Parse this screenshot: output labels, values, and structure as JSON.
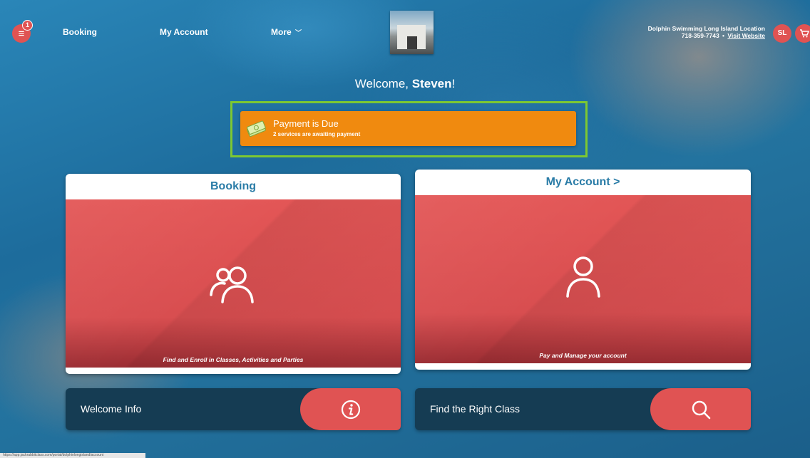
{
  "header": {
    "menu_badge": "1",
    "nav": {
      "booking": "Booking",
      "my_account": "My Account",
      "more": "More"
    },
    "location": {
      "name": "Dolphin Swimming Long Island Location",
      "phone": "718-359-7743",
      "separator": "•",
      "website": "Visit Website"
    },
    "avatar_initials": "SL"
  },
  "welcome": {
    "prefix": "Welcome, ",
    "name": "Steven",
    "suffix": "!"
  },
  "payment": {
    "title": "Payment is Due",
    "subtitle": "2 services are awaiting payment"
  },
  "cards": {
    "booking": {
      "title": "Booking",
      "caption": "Find and Enroll in Classes, Activities and Parties",
      "icon": "users-icon"
    },
    "account": {
      "title": "My Account >",
      "caption": "Pay and Manage your account",
      "icon": "user-icon"
    }
  },
  "bars": {
    "welcome_info": {
      "label": "Welcome Info",
      "icon": "info-icon"
    },
    "find_class": {
      "label": "Find the Right Class",
      "icon": "search-icon"
    }
  },
  "status_url": "https://app.jackrabbitclass.com/portal/dolphinlongisland/account",
  "colors": {
    "accent": "#e05353",
    "payment": "#f08a0f",
    "title_blue": "#2a7ca7",
    "bar_dark": "#153c53",
    "highlight": "#7dc832"
  }
}
